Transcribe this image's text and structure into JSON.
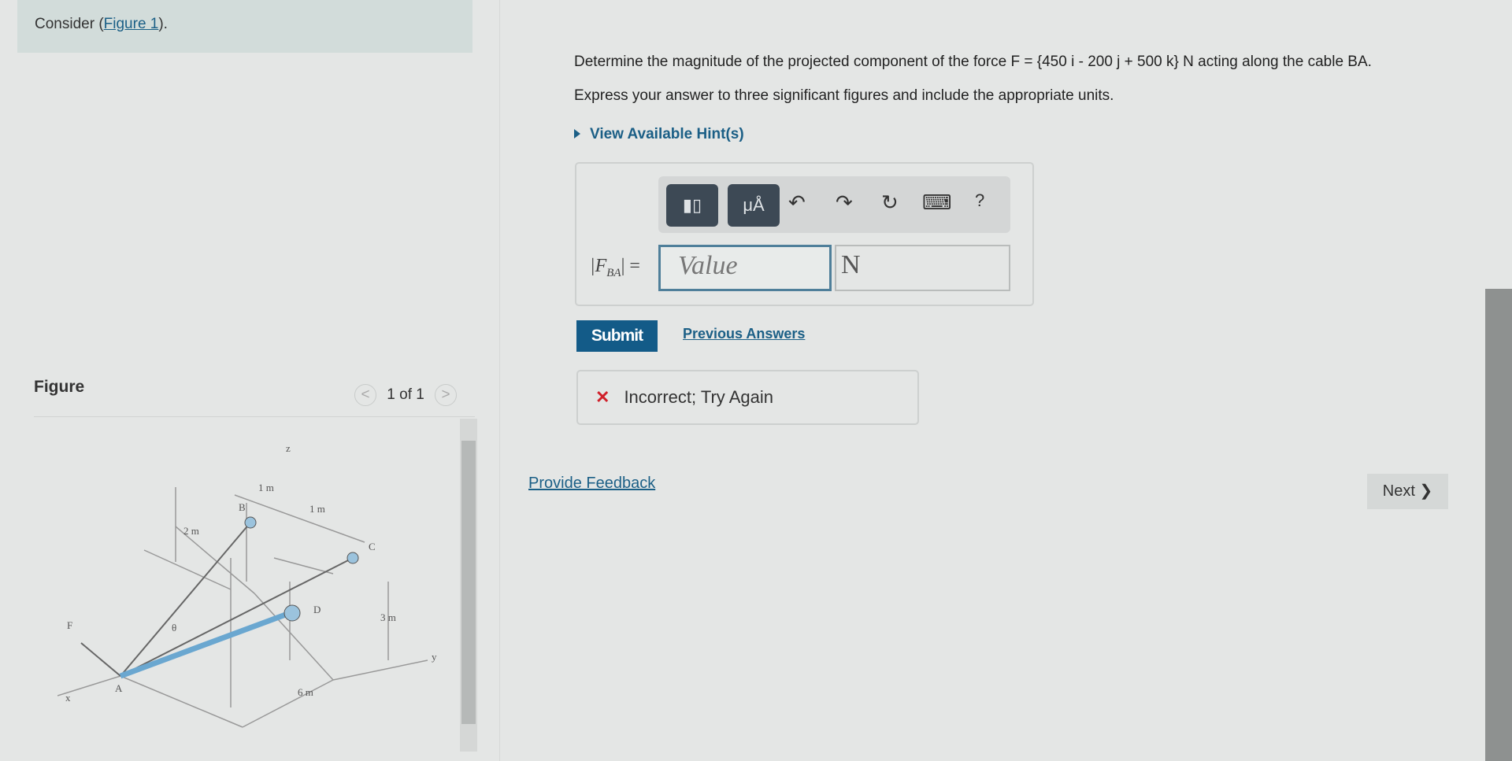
{
  "header": {
    "consider_prefix": "Consider (",
    "figure_link": "Figure 1",
    "consider_suffix": ")."
  },
  "question": {
    "line1": "Determine the magnitude of the projected component of the force F = {450 i - 200 j + 500 k} N acting along the cable BA.",
    "line2": "Express your answer to three significant figures and include the appropriate units.",
    "hint": "View Available Hint(s)"
  },
  "toolbar": {
    "templates_icon": "fraction-template-icon",
    "units_label": "μÅ",
    "undo": "↶",
    "redo": "↷",
    "reset": "↻",
    "keyboard": "⌨",
    "help": "?"
  },
  "answer": {
    "label_main": "|F",
    "label_sub": "BA",
    "label_end": "| =",
    "value_placeholder": "Value",
    "unit_value": "N"
  },
  "actions": {
    "submit": "Submit",
    "previous_answers": "Previous Answers"
  },
  "feedback": {
    "status": "Incorrect; Try Again",
    "icon": "✕",
    "color": "#d0202a"
  },
  "links": {
    "provide_feedback": "Provide Feedback",
    "next": "Next ❯"
  },
  "figure": {
    "title": "Figure",
    "pager": "1 of 1",
    "prev": "<",
    "next": ">",
    "labels": {
      "z": "z",
      "one_m_a": "1 m",
      "one_m_b": "1 m",
      "two_m": "2 m",
      "B": "B",
      "C": "C",
      "D": "D",
      "F": "F",
      "theta": "θ",
      "A": "A",
      "three_m": "3 m",
      "six_m": "6 m",
      "x": "x",
      "y": "y"
    }
  },
  "colors": {
    "accent": "#135b88",
    "link": "#1b5f86"
  }
}
